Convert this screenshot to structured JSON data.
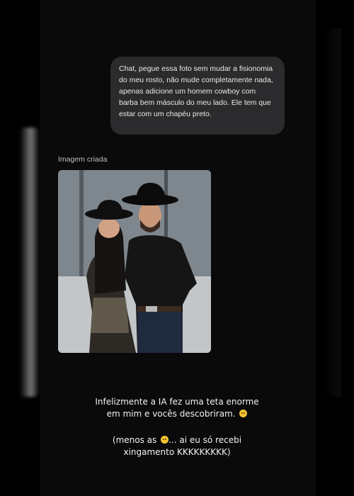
{
  "chat": {
    "user_message": "Chat, pegue essa foto sem mudar a fisionomia do meu rosto, não mude completamente nada, apenas adicione um homem cowboy com barba bem másculo do meu lado. Ele tem que estar com um chapéu preto.",
    "image_caption": "Imagem criada"
  },
  "story": {
    "line1": "Infelizmente a IA fez uma teta enorme",
    "line2": "em mim e vocês descobriram.",
    "line3_a": "(menos as",
    "line3_b": "... ai eu só recebi",
    "line4": "xingamento KKKKKKKKK)"
  },
  "icons": {
    "emoji_sad": "sad-face-emoji",
    "emoji_shy": "shy-face-emoji"
  },
  "colors": {
    "background": "#000000",
    "bubble": "#2b2b2d",
    "text": "#f2f2f2"
  }
}
